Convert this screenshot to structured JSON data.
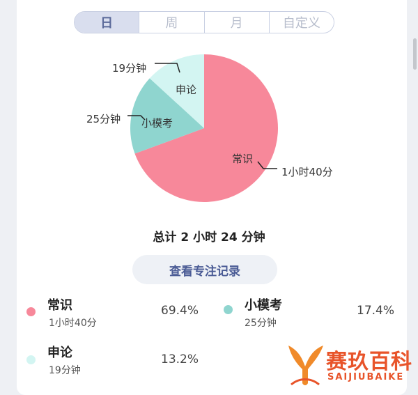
{
  "tabs": [
    {
      "label": "日",
      "active": true
    },
    {
      "label": "周",
      "active": false
    },
    {
      "label": "月",
      "active": false
    },
    {
      "label": "自定义",
      "active": false
    }
  ],
  "chart_data": {
    "type": "pie",
    "slices": [
      {
        "name": "常识",
        "duration": "1小时40分",
        "percent": 69.4,
        "color": "#f7889a"
      },
      {
        "name": "小模考",
        "duration": "25分钟",
        "percent": 17.4,
        "color": "#8fd5cf"
      },
      {
        "name": "申论",
        "duration": "19分钟",
        "percent": 13.2,
        "color": "#d3f5f2"
      }
    ]
  },
  "total_text": "总计 2 小时 24 分钟",
  "view_records_label": "查看专注记录",
  "legend": [
    {
      "name": "常识",
      "sub": "1小时40分",
      "pct": "69.4%",
      "color": "#f7889a"
    },
    {
      "name": "小模考",
      "sub": "25分钟",
      "pct": "17.4%",
      "color": "#8fd5cf"
    },
    {
      "name": "申论",
      "sub": "19分钟",
      "pct": "13.2%",
      "color": "#d3f5f2"
    }
  ],
  "watermark": {
    "title": "赛玖百科",
    "subtitle": "SAIJIUBAIKE"
  }
}
